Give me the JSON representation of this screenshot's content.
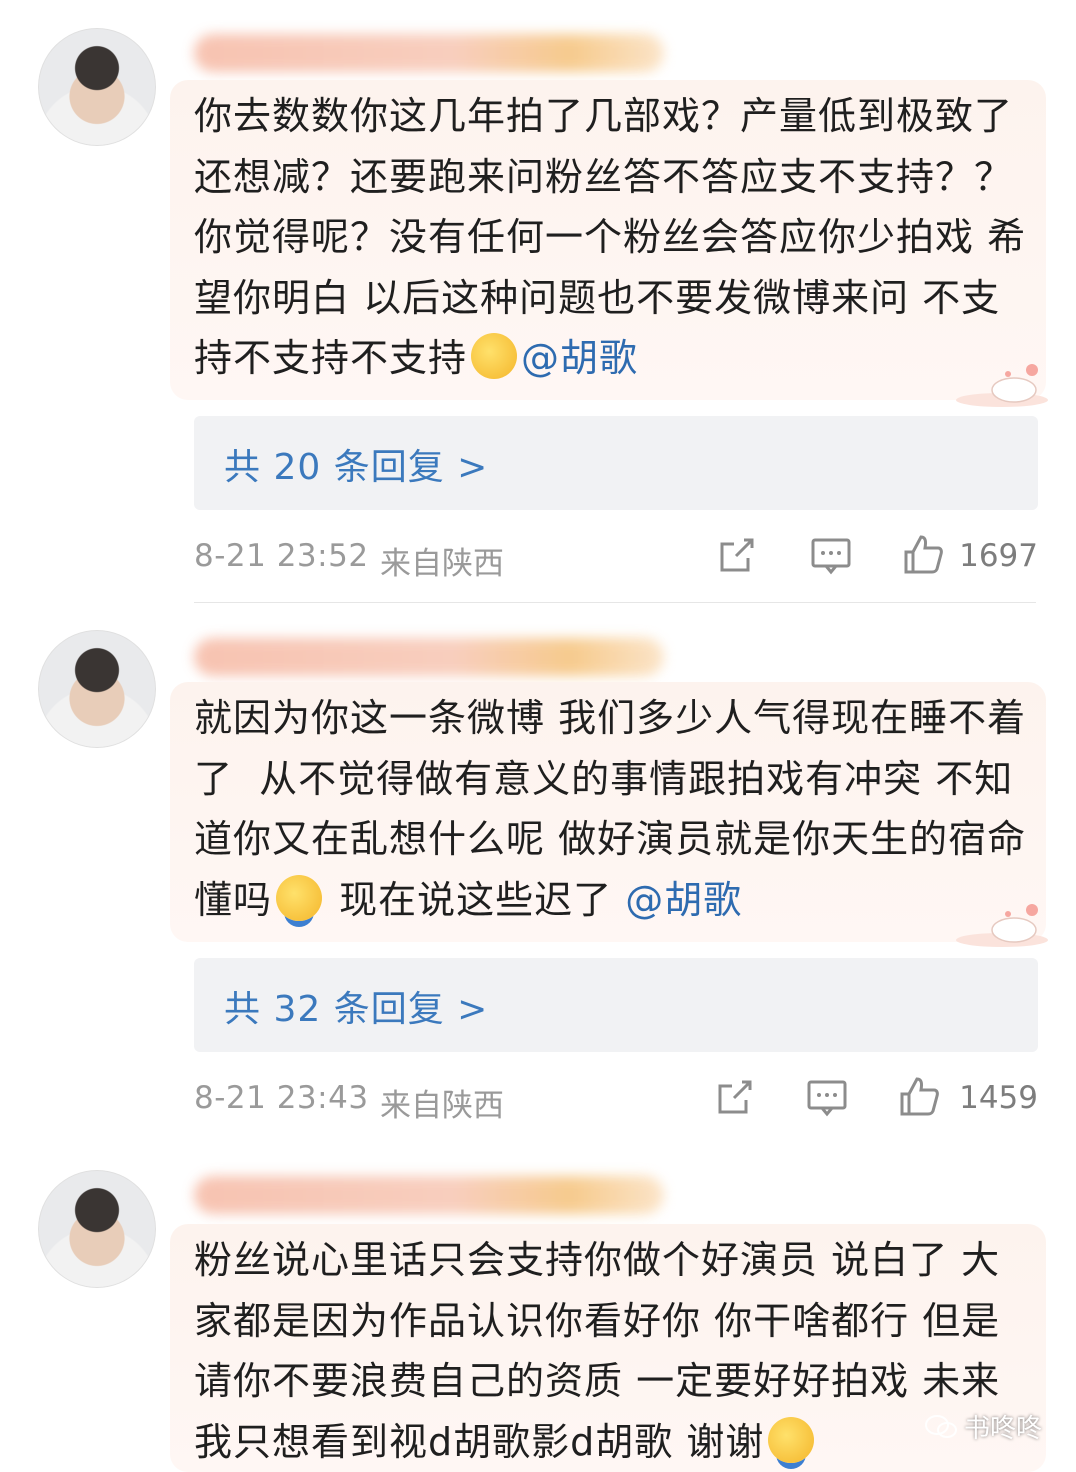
{
  "comments": [
    {
      "text": "你去数数你这几年拍了几部戏？产量低到极致了还想减？还要跑来问粉丝答不答应支不支持？？你觉得呢？没有任何一个粉丝会答应你少拍戏 希望你明白 以后这种问题也不要发微博来问 不支持不支持不支持",
      "emoji_icon": "shushing-face-emoji",
      "mention": "@胡歌",
      "replies": "共 20 条回复 >",
      "time": "8-21 23:52",
      "location": "来自陕西",
      "likes": "1697"
    },
    {
      "text_before": "就因为你这一条微博 我们多少人气得现在睡不着了  从不觉得做有意义的事情跟拍戏有冲突 不知道你又在乱想什么呢 做好演员就是你天生的宿命懂吗",
      "emoji_icon": "crying-face-emoji",
      "text_after": " 现在说这些迟了",
      "mention": "@胡歌",
      "replies": "共 32 条回复 >",
      "time": "8-21 23:43",
      "location": "来自陕西",
      "likes": "1459"
    },
    {
      "text": "粉丝说心里话只会支持你做个好演员 说白了 大家都是因为作品认识你看好你 你干啥都行 但是请你不要浪费自己的资质 一定要好好拍戏 未来我只想看到视d胡歌影d胡歌 谢谢",
      "emoji_icon": "crying-face-emoji"
    }
  ],
  "watermark": "书咚咚",
  "colors": {
    "mention": "#2e6bb0",
    "replies_link": "#3b79bd",
    "meta_text": "#9a9a9a",
    "reply_box": "#f1f2f4",
    "bubble": "#fdf3ee"
  }
}
